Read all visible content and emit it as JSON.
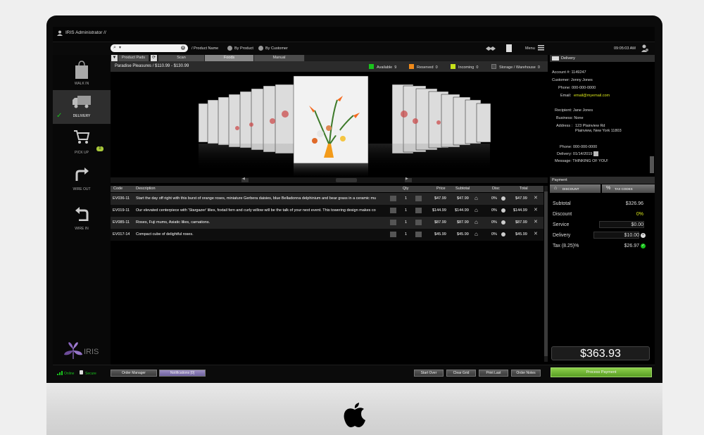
{
  "window": {
    "title": "IRIS Administrator //",
    "clock": "09:05:03 AM"
  },
  "toolbar": {
    "search_placeholder": "",
    "product_name": "/ Product Name",
    "by_product": "By Product",
    "by_customer": "By Customer",
    "menu": "Menu"
  },
  "sidebar": {
    "items": [
      {
        "label": "WALK IN",
        "icon": "shopping-bag-icon"
      },
      {
        "label": "DELIVERY",
        "icon": "delivery-truck-icon",
        "active": true
      },
      {
        "label": "PICK UP",
        "icon": "shopping-cart-icon",
        "badge": "0"
      },
      {
        "label": "WIRE OUT",
        "icon": "arrow-out-icon"
      },
      {
        "label": "WIRE IN",
        "icon": "arrow-in-icon"
      }
    ],
    "logo": "IRIS"
  },
  "tabs": [
    {
      "label": "Product Pads"
    },
    {
      "label": "Scan"
    },
    {
      "label": "Foods"
    },
    {
      "label": "Manual"
    }
  ],
  "product_info": {
    "title": "Paradise Pleasures / $110.99 - $130.99"
  },
  "inventory_legend": [
    {
      "label": "Available",
      "count": "9",
      "color": "#19c31c"
    },
    {
      "label": "Reserved",
      "count": "0",
      "color": "#f08a1a"
    },
    {
      "label": "Incoming",
      "count": "0",
      "color": "#c6e21a"
    },
    {
      "label": "Storage / Warehouse",
      "count": "0",
      "color": "#4a4a4a"
    }
  ],
  "table": {
    "headers": {
      "code": "Code",
      "description": "Description",
      "qty": "Qty",
      "price": "Price",
      "subtotal": "Subtotal",
      "disc": "Disc",
      "total": "Total"
    },
    "rows": [
      {
        "code": "EV036-11",
        "description": "Start the day off right with this burst of orange roses, miniature Gerbera daisies, blue Belladonna delphinium and bear grass in a ceramic mu",
        "qty": "1",
        "price": "$47.99",
        "subtotal": "$47.99",
        "disc": "0%",
        "total": "$47.99"
      },
      {
        "code": "EV019-11",
        "description": "Our elevated centerpiece with 'Stargazer' lilies, foxtail fern and curly willow will be the talk of your next event. This towering design makes co",
        "qty": "1",
        "price": "$144.99",
        "subtotal": "$144.99",
        "disc": "0%",
        "total": "$144.99"
      },
      {
        "code": "EV085-11",
        "description": "Roses, Fuji mums, Asiatic lilies, carnations.",
        "qty": "1",
        "price": "$87.99",
        "subtotal": "$87.99",
        "disc": "0%",
        "total": "$87.99"
      },
      {
        "code": "EV017-14",
        "description": "Compact cube of delightful roses.",
        "qty": "1",
        "price": "$45.99",
        "subtotal": "$45.99",
        "disc": "0%",
        "total": "$45.99"
      }
    ]
  },
  "delivery": {
    "header": "Delivery",
    "account": "Account #:  1149247",
    "customer": "Customer:  Jonny Jones",
    "phone": "Phone:  000-000-0000",
    "email_label": "Email:",
    "email": "email@myemail.com",
    "recipient": "Recipient:  Jane Jones",
    "business": "Business:  None",
    "address_label": "Address :",
    "address_line1": "123 Plainview Rd",
    "address_line2": "Plainview, New York 11803",
    "r_phone": "Phone:  000-000-0000",
    "delivery_date": "Delivery:  01/14/2019",
    "message": "Message:  THINKING OF YOU!"
  },
  "payment": {
    "header": "Payment",
    "discount_btn": "DISCOUNT",
    "tax_codes_btn": "TAX CODES",
    "subtotal_label": "Subtotal",
    "subtotal": "$326.96",
    "discount_label": "Discount",
    "discount": "0%",
    "service_label": "Service",
    "service": "$0.00",
    "delivery_label": "Delivery",
    "delivery": "$10.00",
    "tax_label": "Tax (8.25)%",
    "tax": "$26.97",
    "total": "$363.93",
    "process": "Process Payment"
  },
  "status": {
    "online": "Online",
    "secure": "Secure"
  },
  "bottom": {
    "order_manager": "Order Manager",
    "notifications": "Notifications [0]",
    "start_over": "Start Over",
    "clear_grid": "Clear Grid",
    "print_last": "Print Last",
    "order_notes": "Order Notes"
  },
  "colors": {
    "accent_green": "#19c31c",
    "email_yellow": "#d8e51a",
    "process_green": "#6fb12f"
  }
}
